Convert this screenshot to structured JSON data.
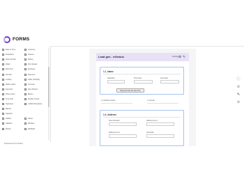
{
  "app": {
    "brand": "FORMS",
    "powered_by": "Powered by Formfind"
  },
  "sidebar": {
    "fields": [
      {
        "left": "Date & Time",
        "right": "Currency"
      },
      {
        "left": "Dropdown",
        "right": "Column"
      },
      {
        "left": "Decimal Slot",
        "right": "Rating"
      },
      {
        "left": "Slider",
        "right": "File Upload"
      },
      {
        "left": "Rich Text",
        "right": "Embrace"
      },
      {
        "left": "Number",
        "right": "Payment"
      },
      {
        "left": "Lookup",
        "right": "Table (Grid)(S)"
      },
      {
        "left": "Radio option",
        "right": "Formula"
      },
      {
        "left": "Keyword",
        "right": "Row Pattern"
      },
      {
        "left": "Phone Num",
        "right": "Button"
      },
      {
        "left": "Time Slot",
        "right": "Double Check"
      },
      {
        "left": "Signature",
        "right": "Unified Dropdown"
      },
      {
        "left": "Banner",
        "right": ""
      },
      {
        "left": "Captcha",
        "right": ""
      },
      {
        "left": "Hidden",
        "right": "Name"
      },
      {
        "left": "Address",
        "right": "Website"
      },
      {
        "left": "Result",
        "right": "Webfield"
      }
    ]
  },
  "form": {
    "title": "Lead gen - eGenius",
    "header_label": "Settings",
    "sections": {
      "name": {
        "title": "1.1_Name",
        "fields": [
          "Salutation",
          "First name",
          "Last name"
        ],
        "drop_label": "Drag and drop the field here"
      },
      "address": {
        "title": "1.4_Address",
        "fields": [
          "Street Number",
          "Address Line 2",
          "Address Line 3",
          "Landmark"
        ]
      }
    },
    "outer_fields": [
      "1.2_Mobile number",
      "1.3_Email"
    ]
  },
  "icons": {
    "accent": "#6a3ec9",
    "header_bg": "#e7e0f7",
    "section_border": "#a9c2ec"
  }
}
